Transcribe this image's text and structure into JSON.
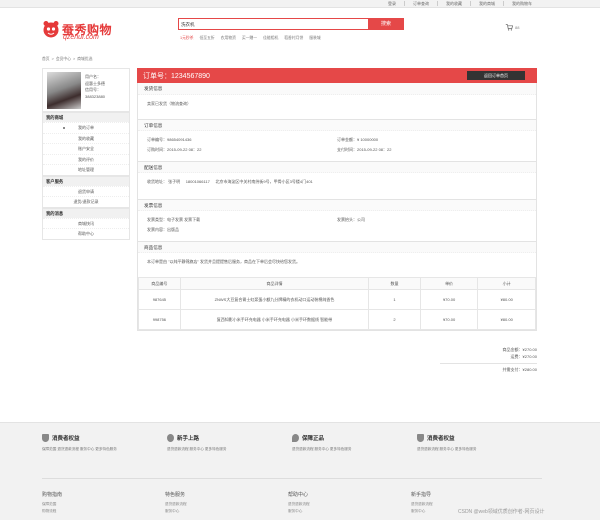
{
  "topbar": {
    "links": [
      "登录",
      "订单查询",
      "我的收藏",
      "我的商城",
      "我的购物车"
    ]
  },
  "logo": {
    "brand": "蚕秀购物",
    "domain": "qzenui.com"
  },
  "search": {
    "value": "洗衣机",
    "button": "搜索"
  },
  "hotwords": [
    "1元秒杀",
    "低至五折",
    "农用物资",
    "买一赠一",
    "佳能相机",
    "稻香村月饼",
    "服装城"
  ],
  "cart": {
    "count": "88"
  },
  "breadcrumb": [
    "首页",
    "会员中心",
    "商城优选"
  ],
  "profile": {
    "user_label": "用户名：",
    "user_name": "迎惠士多德",
    "cert_label": "信用号：",
    "cert_no": "388323880"
  },
  "sidebar": {
    "groups": [
      {
        "title": "我的商城",
        "items": [
          "我的订单",
          "我的收藏",
          "账户安全",
          "我的评价",
          "地址管理"
        ]
      },
      {
        "title": "客户服务",
        "items": [
          "退货申请",
          "退货/退款记录"
        ]
      },
      {
        "title": "我的消息",
        "items": [
          "商城快讯",
          "帮助中心"
        ]
      }
    ]
  },
  "order": {
    "label": "订单号：",
    "number": "1234567890",
    "back_button": "返回订单首页",
    "shipping_title": "发货信息",
    "shipping_text": "卖家已发货（物流查询）",
    "order_info_title": "订单信息",
    "order_no_label": "订单编号：",
    "order_no": "98654091436",
    "amount_label": "订单金额：",
    "amount": "¥ 10000000",
    "order_time_label": "订购时间：",
    "order_time": "2015-09-22 08：22",
    "pay_time_label": "支付时间：",
    "pay_time": "2015-09-22 08：22",
    "delivery_title": "配送信息",
    "address_label": "收货地址：",
    "receiver": "张子明",
    "phone": "18001066117",
    "address": "北京市海淀区中关村南纬街9号，甲骨小区3号楼4门401",
    "invoice_title": "发票信息",
    "invoice_type_label": "发票类型：",
    "invoice_type": "电子发票 发票下载",
    "invoice_head_label": "发票抬头：",
    "invoice_head": "公司",
    "invoice_content_label": "发票内容：",
    "invoice_content": "出版品",
    "goods_title": "商品信息",
    "goods_note": "本订单是由 \"以纯平静锦旗店\" 发货并且提提售后服务，商品在下单后会尽快给您发货。"
  },
  "table": {
    "headers": [
      "商品编号",
      "商品详情",
      "数量",
      "单价",
      "小计"
    ],
    "rows": [
      {
        "id": "987645",
        "detail": "ZNWS大豆复合胃士虹浆蛋小额九分牌精的衣机动口运动装棉纯香色",
        "qty": "1",
        "price": "¥70.00",
        "subtotal": "¥80.00"
      },
      {
        "id": "998756",
        "detail": "复西知影小米手环充电器 小米手环充电器 小米手环数据线 智能带",
        "qty": "2",
        "price": "¥70.00",
        "subtotal": "¥80.00"
      }
    ]
  },
  "summary": {
    "goods_label": "商品金额：",
    "goods_amount": "¥270.00",
    "freight_label": "运费：",
    "freight": "¥270.00",
    "total_label": "共需支付：",
    "total": "¥280.00"
  },
  "footer": {
    "guarantees": [
      {
        "title": "消费者权益",
        "links": "保障范围 退货退款流程 服务中心 更多特色服务"
      },
      {
        "title": "新手上路",
        "links": "退货退款流程 服务中心 更多特色服务"
      },
      {
        "title": "保障正品",
        "links": "退货退款流程 服务中心 更多特色服务"
      },
      {
        "title": "消费者权益",
        "links": "退货退款流程 服务中心 更多特色服务"
      }
    ],
    "columns": [
      {
        "title": "购物指南",
        "links": [
          "保障范围",
          "购物流程"
        ]
      },
      {
        "title": "特色服务",
        "links": [
          "退货退款流程",
          "服务中心"
        ]
      },
      {
        "title": "帮助中心",
        "links": [
          "退货退款流程",
          "服务中心"
        ]
      },
      {
        "title": "新手指导",
        "links": [
          "退货退款流程",
          "服务中心"
        ]
      }
    ],
    "watermark": "CSDN @web领域优质创作者-网页设计"
  },
  "colors": {
    "accent": "#e54848",
    "dark": "#333333"
  }
}
